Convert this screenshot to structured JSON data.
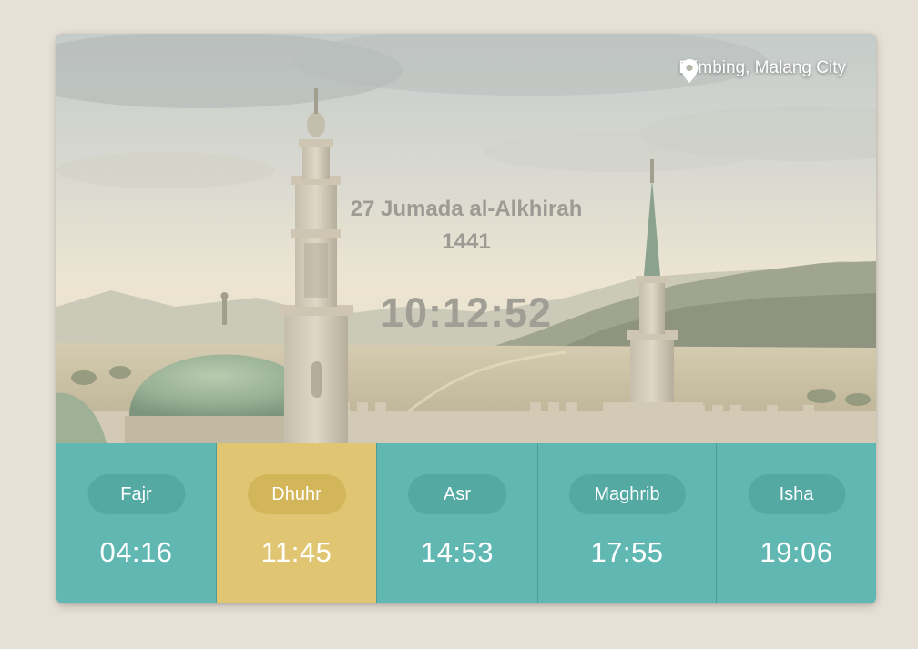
{
  "location": {
    "icon": "location-pin-icon",
    "label": "Blimbing, Malang City"
  },
  "date": {
    "hijri_day_month": "27 Jumada al-Alkhirah",
    "hijri_year": "1441"
  },
  "clock": {
    "time": "10:12:52"
  },
  "prayers": [
    {
      "name": "Fajr",
      "time": "04:16"
    },
    {
      "name": "Dhuhr",
      "time": "11:45",
      "active": true
    },
    {
      "name": "Asr",
      "time": "14:53"
    },
    {
      "name": "Maghrib",
      "time": "17:55"
    },
    {
      "name": "Isha",
      "time": "19:06"
    }
  ],
  "colors": {
    "page_background": "#e6e0d6",
    "prayer_background": "#61b8b2",
    "active_prayer_background": "#e0c672",
    "text_light": "#ffffff"
  }
}
